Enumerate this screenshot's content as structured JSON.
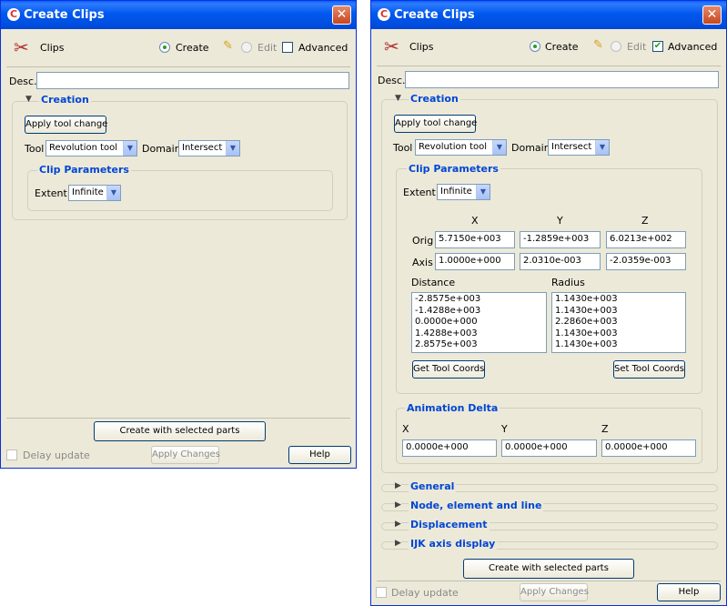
{
  "window_title": "Create Clips",
  "header": {
    "section": "Clips",
    "mode_create": "Create",
    "mode_edit": "Edit",
    "advanced": "Advanced"
  },
  "desc_label": "Desc.",
  "creation": {
    "title": "Creation",
    "apply_tool_change": "Apply tool change",
    "tool_label": "Tool",
    "tool_value": "Revolution tool",
    "domain_label": "Domain",
    "domain_value": "Intersect"
  },
  "clip_parameters": {
    "title": "Clip Parameters",
    "extent_label": "Extent",
    "extent_value": "Infinite",
    "col_x": "X",
    "col_y": "Y",
    "col_z": "Z",
    "orig_label": "Orig",
    "orig": [
      "5.7150e+003",
      "-1.2859e+003",
      "6.0213e+002"
    ],
    "axis_label": "Axis",
    "axis": [
      "1.0000e+000",
      "2.0310e-003",
      "-2.0359e-003"
    ],
    "distance_label": "Distance",
    "radius_label": "Radius",
    "distance": [
      "-2.8575e+003",
      "-1.4288e+003",
      "0.0000e+000",
      "1.4288e+003",
      "2.8575e+003"
    ],
    "radius": [
      "1.1430e+003",
      "1.1430e+003",
      "2.2860e+003",
      "1.1430e+003",
      "1.1430e+003"
    ],
    "get_tool_coords": "Get Tool Coords",
    "set_tool_coords": "Set Tool Coords"
  },
  "animation_delta": {
    "title": "Animation Delta",
    "x_label": "X",
    "y_label": "Y",
    "z_label": "Z",
    "x": "0.0000e+000",
    "y": "0.0000e+000",
    "z": "0.0000e+000"
  },
  "collapsed_sections": [
    "General",
    "Node, element and line",
    "Displacement",
    "IJK axis display"
  ],
  "footer": {
    "create_button": "Create with selected parts",
    "delay_update": "Delay update",
    "apply_changes": "Apply Changes",
    "help": "Help"
  }
}
